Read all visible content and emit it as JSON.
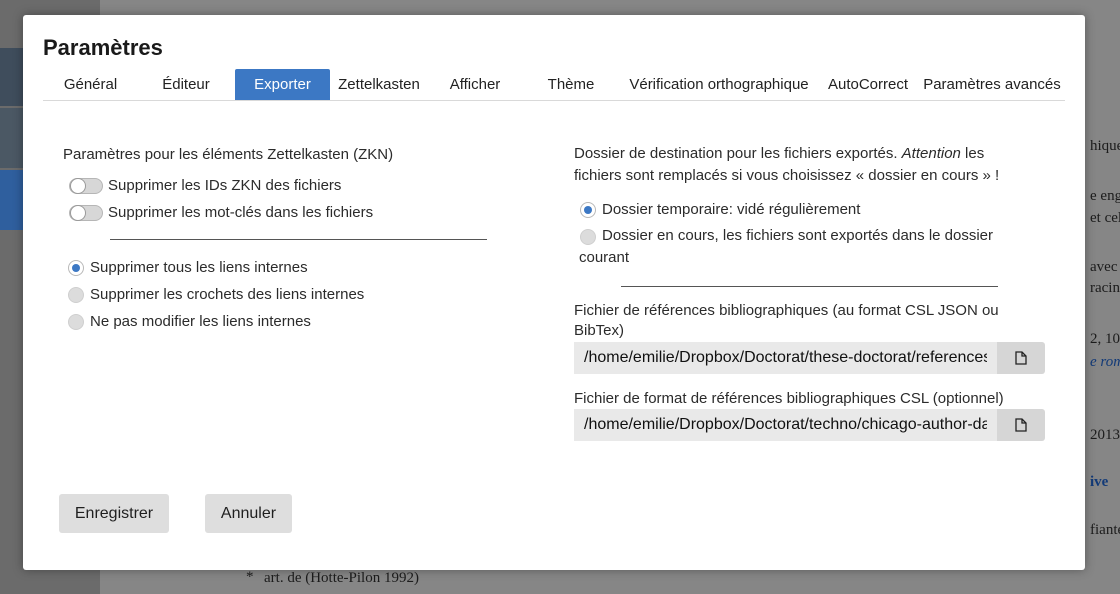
{
  "background": {
    "text_fragments": [
      "hique",
      "e eng",
      "et cell",
      "avec",
      "racine",
      "2, 10",
      "e rom",
      "2013",
      "ive",
      "fiante",
      "*",
      "art. de (Hotte-Pilon 1992)"
    ]
  },
  "dialog": {
    "title": "Paramètres",
    "tabs": [
      "Général",
      "Éditeur",
      "Exporter",
      "Zettelkasten",
      "Afficher",
      "Thème",
      "Vérification orthographique",
      "AutoCorrect",
      "Paramètres avancés"
    ],
    "active_tab": "Exporter",
    "left": {
      "section_label": "Paramètres pour les éléments Zettelkasten (ZKN)",
      "toggles": [
        {
          "label": "Supprimer les IDs ZKN des fichiers",
          "on": false
        },
        {
          "label": "Supprimer les mot-clés dans les fichiers",
          "on": false
        }
      ],
      "link_options": [
        {
          "label": "Supprimer tous les liens internes",
          "selected": true
        },
        {
          "label": "Supprimer les crochets des liens internes",
          "selected": false
        },
        {
          "label": "Ne pas modifier les liens internes",
          "selected": false
        }
      ]
    },
    "right": {
      "dest_text_1": "Dossier de destination pour les fichiers exportés. ",
      "dest_text_em": "Attention",
      "dest_text_2": " les fichiers sont remplacés si vous choisissez « dossier en cours » !",
      "dest_options": [
        {
          "label": "Dossier temporaire: vidé régulièrement",
          "selected": true
        },
        {
          "label": "Dossier en cours, les fichiers sont exportés dans le dossier courant",
          "selected": false
        }
      ],
      "bib_label": "Fichier de références bibliographiques (au format CSL JSON ou BibTex)",
      "bib_value": "/home/emilie/Dropbox/Doctorat/these-doctorat/references.json",
      "csl_label": "Fichier de format de références bibliographiques CSL (optionnel)",
      "csl_value": "/home/emilie/Dropbox/Doctorat/techno/chicago-author-date.csl"
    },
    "buttons": {
      "save": "Enregistrer",
      "cancel": "Annuler"
    }
  },
  "colors": {
    "accent": "#3c78c4"
  },
  "icons": {
    "file_picker": "file-icon"
  }
}
